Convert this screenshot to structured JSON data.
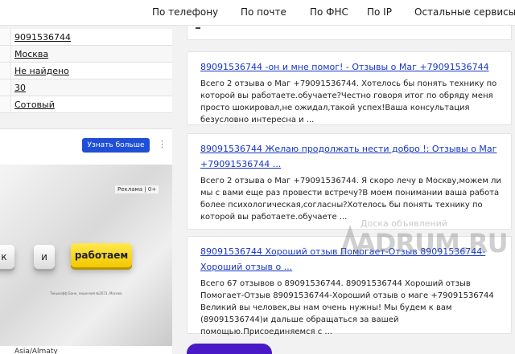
{
  "nav": {
    "items": [
      "По телефону",
      "По почте",
      "По ФНС",
      "По IP",
      "Остальные сервисы"
    ]
  },
  "info": {
    "rows": [
      "9091536744",
      "Москва",
      "Не найдено",
      "30",
      "Сотовый"
    ]
  },
  "ad": {
    "button_label": "Узнать больше",
    "menu_icon": "more-vertical-icon",
    "tag": "Реклама | 0+",
    "keys": [
      "к",
      "и",
      "работаем"
    ],
    "fine_print": "Тинькофф Банк, лицензия №2673, Москва.",
    "bottom_text": "Asia/Almaty"
  },
  "reviews": [
    {
      "title": "89091536744 -он и мне помог! - Отзывы о Маг +79091536744",
      "body": "Всего 2 отзыва о Маг +79091536744. Хотелось бы понять технику по которой вы работаете.обучаете?Честно говоря итог по обряду меня просто шокировал,не ожидал,такой успех!Ваша консультация безусловно интересна и ..."
    },
    {
      "title": "89091536744 Желаю продолжать нести добро !: Отзывы о Маг +79091536744 ...",
      "body": "Всего 2 отзыва о Маг +79091536744. Я скоро лечу в Москву,можем ли мы с вами еще раз провести встречу?В моем понимании ваша работа более психологическая,согласны?Хотелось бы понять технику по которой вы работаете.обучаете ..."
    },
    {
      "title": "89091536744 Хороший отзыв Помогает-Отзыв 89091536744-Хороший отзыв о ...",
      "body": "Всего 67 отзывов о 89091536744. 89091536744 Хороший отзыв Помогает-Отзыв 89091536744-Хороший отзыв о маге +79091536744 Великий вы человек,вы нам очень нужны! Мы будем к вам (89091536744)и дальше обращаться за вашей помощью.Присоединяемся с ..."
    }
  ],
  "watermark": {
    "line1": "Доска объявлений",
    "line2": "ADRUM.RU"
  },
  "colors": {
    "link": "#1736c4",
    "ad_button": "#1f4fd6",
    "ad_key_yellow": "#f2c800",
    "purple_button": "#4a19c7"
  }
}
